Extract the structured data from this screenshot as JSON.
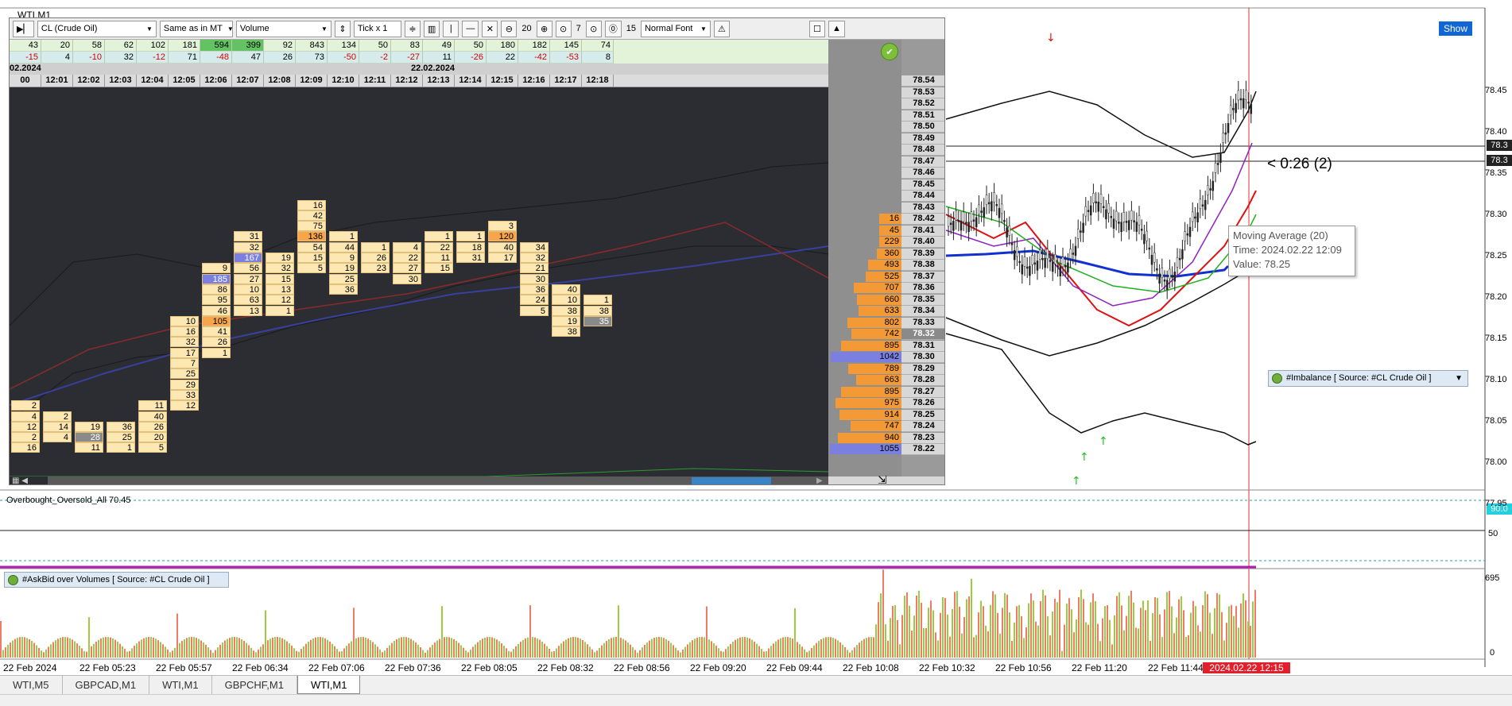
{
  "window": {
    "title": "WTI,M1",
    "show_label": "Show"
  },
  "toolbar": {
    "symbol": "CL (Crude Oil)",
    "session": "Same as in MT",
    "mode": "Volume",
    "tick": "Tick x 1",
    "n1": "20",
    "n2": "7",
    "n3": "15",
    "font": "Normal Font"
  },
  "delta_row1": [
    "43",
    "20",
    "58",
    "62",
    "102",
    "181",
    "594",
    "399",
    "92",
    "843",
    "134",
    "50",
    "83",
    "49",
    "50",
    "180",
    "182",
    "145",
    "74"
  ],
  "delta_row2": [
    "-15",
    "4",
    "-10",
    "32",
    "-12",
    "71",
    "-48",
    "47",
    "26",
    "73",
    "-50",
    "-2",
    "-27",
    "11",
    "-26",
    "22",
    "-42",
    "-53",
    "8"
  ],
  "dates": {
    "left": "02.2024",
    "mid": "22.02.2024"
  },
  "times": [
    "00",
    "12:01",
    "12:02",
    "12:03",
    "12:04",
    "12:05",
    "12:06",
    "12:07",
    "12:08",
    "12:09",
    "12:10",
    "12:11",
    "12:12",
    "12:13",
    "12:14",
    "12:15",
    "12:16",
    "12:17",
    "12:18"
  ],
  "footprint_cells": [
    {
      "col": 0,
      "row": 24,
      "v": "2"
    },
    {
      "col": 0,
      "row": 25,
      "v": "4"
    },
    {
      "col": 0,
      "row": 26,
      "v": "12"
    },
    {
      "col": 0,
      "row": 27,
      "v": "2"
    },
    {
      "col": 0,
      "row": 28,
      "v": "16"
    },
    {
      "col": 1,
      "row": 25,
      "v": "2"
    },
    {
      "col": 1,
      "row": 26,
      "v": "14"
    },
    {
      "col": 1,
      "row": 27,
      "v": "4"
    },
    {
      "col": 2,
      "row": 26,
      "v": "19"
    },
    {
      "col": 2,
      "row": 27,
      "v": "28",
      "t": "grey"
    },
    {
      "col": 2,
      "row": 28,
      "v": "11"
    },
    {
      "col": 3,
      "row": 26,
      "v": "36"
    },
    {
      "col": 3,
      "row": 27,
      "v": "25"
    },
    {
      "col": 3,
      "row": 28,
      "v": "1"
    },
    {
      "col": 4,
      "row": 24,
      "v": "11"
    },
    {
      "col": 4,
      "row": 25,
      "v": "40"
    },
    {
      "col": 4,
      "row": 26,
      "v": "26"
    },
    {
      "col": 4,
      "row": 27,
      "v": "20"
    },
    {
      "col": 4,
      "row": 28,
      "v": "5"
    },
    {
      "col": 5,
      "row": 16,
      "v": "10"
    },
    {
      "col": 5,
      "row": 17,
      "v": "16"
    },
    {
      "col": 5,
      "row": 18,
      "v": "32"
    },
    {
      "col": 5,
      "row": 19,
      "v": "17"
    },
    {
      "col": 5,
      "row": 20,
      "v": "7"
    },
    {
      "col": 5,
      "row": 21,
      "v": "25"
    },
    {
      "col": 5,
      "row": 22,
      "v": "29"
    },
    {
      "col": 5,
      "row": 23,
      "v": "33"
    },
    {
      "col": 5,
      "row": 24,
      "v": "12"
    },
    {
      "col": 6,
      "row": 11,
      "v": "9"
    },
    {
      "col": 6,
      "row": 12,
      "v": "185",
      "t": "blue"
    },
    {
      "col": 6,
      "row": 13,
      "v": "86"
    },
    {
      "col": 6,
      "row": 14,
      "v": "95"
    },
    {
      "col": 6,
      "row": 15,
      "v": "46"
    },
    {
      "col": 6,
      "row": 16,
      "v": "105",
      "t": "hi"
    },
    {
      "col": 6,
      "row": 17,
      "v": "41"
    },
    {
      "col": 6,
      "row": 18,
      "v": "26"
    },
    {
      "col": 6,
      "row": 19,
      "v": "1"
    },
    {
      "col": 7,
      "row": 8,
      "v": "31"
    },
    {
      "col": 7,
      "row": 9,
      "v": "32"
    },
    {
      "col": 7,
      "row": 10,
      "v": "167",
      "t": "blue"
    },
    {
      "col": 7,
      "row": 11,
      "v": "56"
    },
    {
      "col": 7,
      "row": 12,
      "v": "27"
    },
    {
      "col": 7,
      "row": 13,
      "v": "10"
    },
    {
      "col": 7,
      "row": 14,
      "v": "63"
    },
    {
      "col": 7,
      "row": 15,
      "v": "13"
    },
    {
      "col": 8,
      "row": 10,
      "v": "19"
    },
    {
      "col": 8,
      "row": 11,
      "v": "32"
    },
    {
      "col": 8,
      "row": 12,
      "v": "15"
    },
    {
      "col": 8,
      "row": 13,
      "v": "13"
    },
    {
      "col": 8,
      "row": 14,
      "v": "12"
    },
    {
      "col": 8,
      "row": 15,
      "v": "1"
    },
    {
      "col": 9,
      "row": 5,
      "v": "16"
    },
    {
      "col": 9,
      "row": 6,
      "v": "42"
    },
    {
      "col": 9,
      "row": 7,
      "v": "75"
    },
    {
      "col": 9,
      "row": 8,
      "v": "136",
      "t": "hi"
    },
    {
      "col": 9,
      "row": 9,
      "v": "54"
    },
    {
      "col": 9,
      "row": 10,
      "v": "15"
    },
    {
      "col": 9,
      "row": 11,
      "v": "5"
    },
    {
      "col": 10,
      "row": 8,
      "v": "1"
    },
    {
      "col": 10,
      "row": 9,
      "v": "44"
    },
    {
      "col": 10,
      "row": 10,
      "v": "9"
    },
    {
      "col": 10,
      "row": 11,
      "v": "19"
    },
    {
      "col": 10,
      "row": 12,
      "v": "25"
    },
    {
      "col": 10,
      "row": 13,
      "v": "36"
    },
    {
      "col": 11,
      "row": 9,
      "v": "1"
    },
    {
      "col": 11,
      "row": 10,
      "v": "26"
    },
    {
      "col": 11,
      "row": 11,
      "v": "23"
    },
    {
      "col": 12,
      "row": 9,
      "v": "4"
    },
    {
      "col": 12,
      "row": 10,
      "v": "22"
    },
    {
      "col": 12,
      "row": 11,
      "v": "27"
    },
    {
      "col": 12,
      "row": 12,
      "v": "30"
    },
    {
      "col": 13,
      "row": 8,
      "v": "1"
    },
    {
      "col": 13,
      "row": 9,
      "v": "22"
    },
    {
      "col": 13,
      "row": 10,
      "v": "11"
    },
    {
      "col": 13,
      "row": 11,
      "v": "15"
    },
    {
      "col": 14,
      "row": 8,
      "v": "1"
    },
    {
      "col": 14,
      "row": 9,
      "v": "18"
    },
    {
      "col": 14,
      "row": 10,
      "v": "31"
    },
    {
      "col": 15,
      "row": 7,
      "v": "3"
    },
    {
      "col": 15,
      "row": 8,
      "v": "120",
      "t": "hi"
    },
    {
      "col": 15,
      "row": 9,
      "v": "40"
    },
    {
      "col": 15,
      "row": 10,
      "v": "17"
    },
    {
      "col": 16,
      "row": 9,
      "v": "34"
    },
    {
      "col": 16,
      "row": 10,
      "v": "32"
    },
    {
      "col": 16,
      "row": 11,
      "v": "21"
    },
    {
      "col": 16,
      "row": 12,
      "v": "30"
    },
    {
      "col": 16,
      "row": 13,
      "v": "36"
    },
    {
      "col": 16,
      "row": 14,
      "v": "24"
    },
    {
      "col": 16,
      "row": 15,
      "v": "5"
    },
    {
      "col": 17,
      "row": 13,
      "v": "40"
    },
    {
      "col": 17,
      "row": 14,
      "v": "10"
    },
    {
      "col": 17,
      "row": 15,
      "v": "38"
    },
    {
      "col": 17,
      "row": 16,
      "v": "19"
    },
    {
      "col": 17,
      "row": 17,
      "v": "38"
    },
    {
      "col": 18,
      "row": 14,
      "v": "1"
    },
    {
      "col": 18,
      "row": 15,
      "v": "38"
    },
    {
      "col": 18,
      "row": 16,
      "v": "35",
      "t": "grey"
    }
  ],
  "profile": [
    {
      "price": "78.54",
      "vol": ""
    },
    {
      "price": "78.53",
      "vol": ""
    },
    {
      "price": "78.52",
      "vol": ""
    },
    {
      "price": "78.51",
      "vol": ""
    },
    {
      "price": "78.50",
      "vol": ""
    },
    {
      "price": "78.49",
      "vol": ""
    },
    {
      "price": "78.48",
      "vol": ""
    },
    {
      "price": "78.47",
      "vol": ""
    },
    {
      "price": "78.46",
      "vol": ""
    },
    {
      "price": "78.45",
      "vol": ""
    },
    {
      "price": "78.44",
      "vol": ""
    },
    {
      "price": "78.43",
      "vol": ""
    },
    {
      "price": "78.42",
      "vol": "16"
    },
    {
      "price": "78.41",
      "vol": "45"
    },
    {
      "price": "78.40",
      "vol": "229"
    },
    {
      "price": "78.39",
      "vol": "360"
    },
    {
      "price": "78.38",
      "vol": "493"
    },
    {
      "price": "78.37",
      "vol": "525"
    },
    {
      "price": "78.36",
      "vol": "707"
    },
    {
      "price": "78.35",
      "vol": "660"
    },
    {
      "price": "78.34",
      "vol": "633"
    },
    {
      "price": "78.33",
      "vol": "802"
    },
    {
      "price": "78.32",
      "vol": "742"
    },
    {
      "price": "78.31",
      "vol": "895"
    },
    {
      "price": "78.30",
      "vol": "1042"
    },
    {
      "price": "78.29",
      "vol": "789"
    },
    {
      "price": "78.28",
      "vol": "663"
    },
    {
      "price": "78.27",
      "vol": "895"
    },
    {
      "price": "78.26",
      "vol": "975"
    },
    {
      "price": "78.25",
      "vol": "914"
    },
    {
      "price": "78.24",
      "vol": "747"
    },
    {
      "price": "78.23",
      "vol": "940"
    },
    {
      "price": "78.22",
      "vol": "1055"
    }
  ],
  "tooltip": {
    "line1": "Moving Average (20)",
    "line2": "Time: 2024.02.22 12:09",
    "line3": "Value: 78.25"
  },
  "timer": "0:26 (2)",
  "imbalance_legend": "#Imbalance [ Source: #CL Crude Oil ]",
  "oscillator": {
    "label": "Overbought_Oversold_All 70.45",
    "level_mid": "50",
    "level_top": "90.0"
  },
  "askbid_legend": "#AskBid over Volumes [ Source: #CL Crude Oil ]",
  "volume_axis_max": "695",
  "volume_axis_min": "0",
  "price_axis": [
    "78.45",
    "78.40",
    "78.35",
    "78.30",
    "78.25",
    "78.20",
    "78.15",
    "78.10",
    "78.05",
    "78.00",
    "77.95"
  ],
  "price_tags": {
    "top": "78.3",
    "bottom": "78.3"
  },
  "time_axis": [
    "22 Feb 2024",
    "22 Feb 05:23",
    "22 Feb 05:57",
    "22 Feb 06:34",
    "22 Feb 07:06",
    "22 Feb 07:36",
    "22 Feb 08:05",
    "22 Feb 08:32",
    "22 Feb 08:56",
    "22 Feb 09:20",
    "22 Feb 09:44",
    "22 Feb 10:08",
    "22 Feb 10:32",
    "22 Feb 10:56",
    "22 Feb 11:20",
    "22 Feb 11:44"
  ],
  "current_time": "2024.02.22 12:15",
  "tabs": [
    {
      "label": "WTI,M5",
      "active": false
    },
    {
      "label": "GBPCAD,M1",
      "active": false
    },
    {
      "label": "WTI,M1",
      "active": false
    },
    {
      "label": "GBPCHF,M1",
      "active": false
    },
    {
      "label": "WTI,M1",
      "active": true
    }
  ],
  "colors": {
    "accent_blue": "#1166d6",
    "bull": "#63c363",
    "bear": "#d40000",
    "time_tag": "#e0202a"
  }
}
